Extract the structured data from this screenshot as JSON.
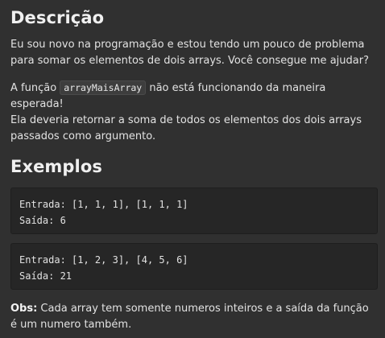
{
  "description": {
    "title": "Descrição",
    "paragraph1": "Eu sou novo na programação e estou tendo um pouco de problema para somar os elementos de dois arrays. Você consegue me ajudar?",
    "paragraph2_before": "A função ",
    "function_name": "arrayMaisArray",
    "paragraph2_after": " não está funcionando da maneira esperada!",
    "paragraph2_line2": "Ela deveria retornar a soma de todos os elementos dos dois arrays passados como argumento."
  },
  "examples": {
    "title": "Exemplos",
    "items": [
      {
        "input": "Entrada: [1, 1, 1], [1, 1, 1]",
        "output": "Saída: 6"
      },
      {
        "input": "Entrada: [1, 2, 3], [4, 5, 6]",
        "output": "Saída: 21"
      }
    ]
  },
  "note": {
    "label": "Obs:",
    "text": " Cada array tem somente numeros inteiros e a saída da função é um numero também."
  }
}
